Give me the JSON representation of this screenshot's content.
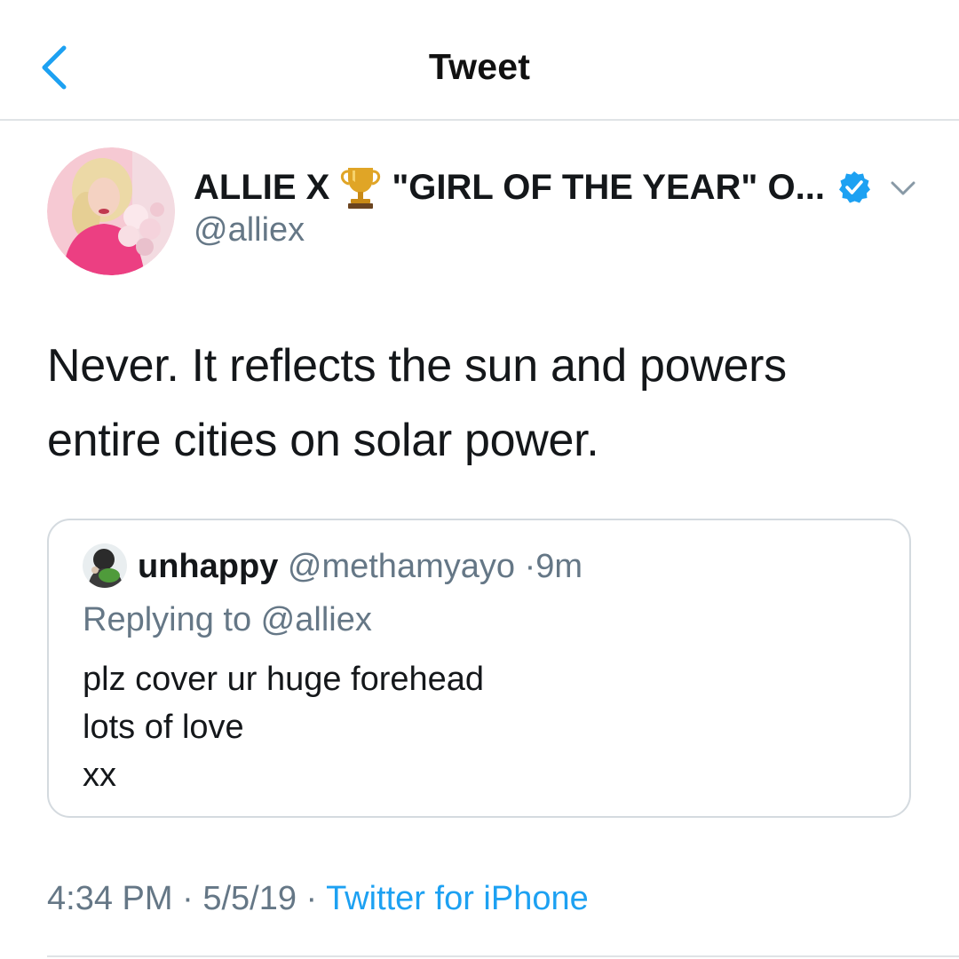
{
  "header": {
    "title": "Tweet",
    "back_icon": "chevron-left-icon",
    "accent_color": "#1da1f2"
  },
  "tweet": {
    "author": {
      "name_prefix": "ALLIE X",
      "name_emoji": "trophy-icon",
      "name_suffix": "\"GIRL OF THE YEAR\" O...",
      "handle": "@alliex",
      "verified": true,
      "avatar": "profile-photo"
    },
    "text_line_1": "Never. It reflects the sun and powers",
    "text_line_2": "entire cities on solar power.",
    "quoted": {
      "name": "unhappy",
      "handle": "@methamyayo",
      "separator": "·",
      "time": "9m",
      "replying_to": "Replying to @alliex",
      "body_lines": [
        "plz cover ur huge forehead",
        "lots of love",
        "xx"
      ]
    },
    "meta": {
      "time": "4:34 PM",
      "sep1": "·",
      "date": "5/5/19",
      "sep2": "·",
      "source": "Twitter for iPhone"
    }
  }
}
